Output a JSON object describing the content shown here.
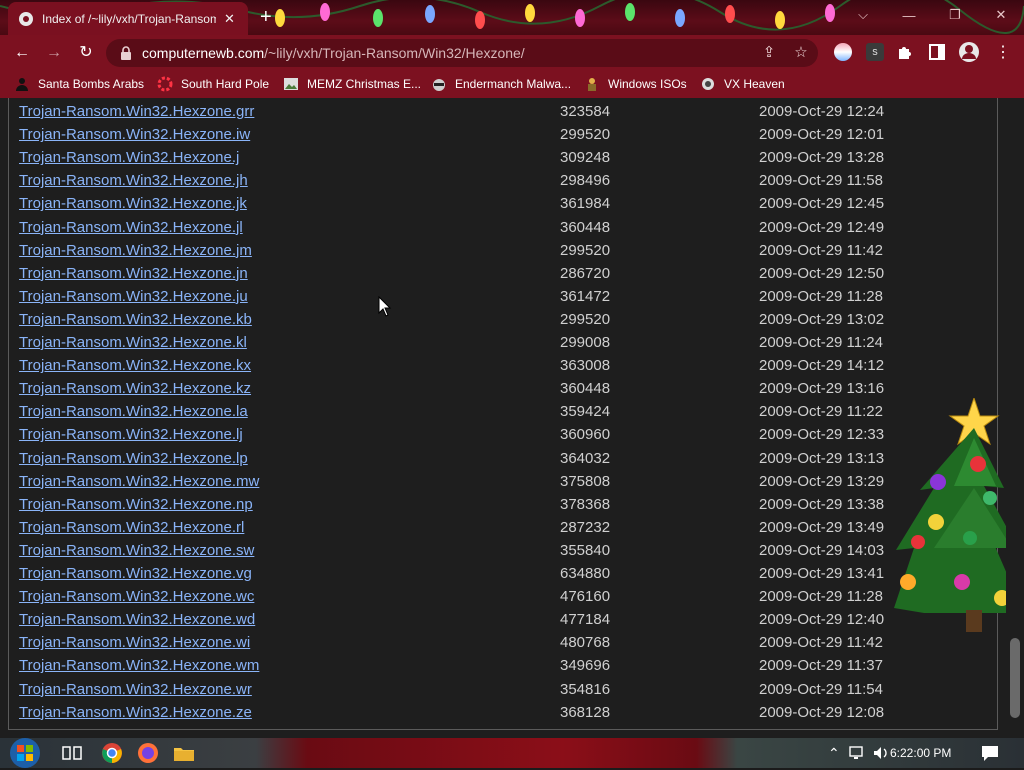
{
  "window": {
    "tab_title": "Index of /~lily/vxh/Trojan-Ransom",
    "tab_close": "✕",
    "new_tab": "+",
    "controls": [
      "⌵",
      "—",
      "❐",
      "✕"
    ]
  },
  "toolbar": {
    "back": "←",
    "forward": "→",
    "reload": "↻",
    "url_host": "computernewb.com",
    "url_path": "/~lily/vxh/Trojan-Ransom/Win32/Hexzone/",
    "share": "⇪",
    "bookmark_star": "☆",
    "menu": "⋮"
  },
  "bookmarks": [
    {
      "label": "Santa Bombs Arabs",
      "icon": "user-silhouette-icon"
    },
    {
      "label": "South Hard Pole",
      "icon": "red-flower-icon"
    },
    {
      "label": "MEMZ Christmas E...",
      "icon": "image-icon"
    },
    {
      "label": "Endermanch Malwa...",
      "icon": "raccoon-icon"
    },
    {
      "label": "Windows ISOs",
      "icon": "miner-icon"
    },
    {
      "label": "VX Heaven",
      "icon": "vx-icon"
    }
  ],
  "listing": [
    {
      "name": "Trojan-Ransom.Win32.Hexzone.grr",
      "size": "323584",
      "date": "2009-Oct-29 12:24"
    },
    {
      "name": "Trojan-Ransom.Win32.Hexzone.iw",
      "size": "299520",
      "date": "2009-Oct-29 12:01"
    },
    {
      "name": "Trojan-Ransom.Win32.Hexzone.j",
      "size": "309248",
      "date": "2009-Oct-29 13:28"
    },
    {
      "name": "Trojan-Ransom.Win32.Hexzone.jh",
      "size": "298496",
      "date": "2009-Oct-29 11:58"
    },
    {
      "name": "Trojan-Ransom.Win32.Hexzone.jk",
      "size": "361984",
      "date": "2009-Oct-29 12:45"
    },
    {
      "name": "Trojan-Ransom.Win32.Hexzone.jl",
      "size": "360448",
      "date": "2009-Oct-29 12:49"
    },
    {
      "name": "Trojan-Ransom.Win32.Hexzone.jm",
      "size": "299520",
      "date": "2009-Oct-29 11:42"
    },
    {
      "name": "Trojan-Ransom.Win32.Hexzone.jn",
      "size": "286720",
      "date": "2009-Oct-29 12:50"
    },
    {
      "name": "Trojan-Ransom.Win32.Hexzone.ju",
      "size": "361472",
      "date": "2009-Oct-29 11:28"
    },
    {
      "name": "Trojan-Ransom.Win32.Hexzone.kb",
      "size": "299520",
      "date": "2009-Oct-29 13:02"
    },
    {
      "name": "Trojan-Ransom.Win32.Hexzone.kl",
      "size": "299008",
      "date": "2009-Oct-29 11:24"
    },
    {
      "name": "Trojan-Ransom.Win32.Hexzone.kx",
      "size": "363008",
      "date": "2009-Oct-29 14:12"
    },
    {
      "name": "Trojan-Ransom.Win32.Hexzone.kz",
      "size": "360448",
      "date": "2009-Oct-29 13:16"
    },
    {
      "name": "Trojan-Ransom.Win32.Hexzone.la",
      "size": "359424",
      "date": "2009-Oct-29 11:22"
    },
    {
      "name": "Trojan-Ransom.Win32.Hexzone.lj",
      "size": "360960",
      "date": "2009-Oct-29 12:33"
    },
    {
      "name": "Trojan-Ransom.Win32.Hexzone.lp",
      "size": "364032",
      "date": "2009-Oct-29 13:13"
    },
    {
      "name": "Trojan-Ransom.Win32.Hexzone.mw",
      "size": "375808",
      "date": "2009-Oct-29 13:29"
    },
    {
      "name": "Trojan-Ransom.Win32.Hexzone.np",
      "size": "378368",
      "date": "2009-Oct-29 13:38"
    },
    {
      "name": "Trojan-Ransom.Win32.Hexzone.rl",
      "size": "287232",
      "date": "2009-Oct-29 13:49"
    },
    {
      "name": "Trojan-Ransom.Win32.Hexzone.sw",
      "size": "355840",
      "date": "2009-Oct-29 14:03"
    },
    {
      "name": "Trojan-Ransom.Win32.Hexzone.vg",
      "size": "634880",
      "date": "2009-Oct-29 13:41"
    },
    {
      "name": "Trojan-Ransom.Win32.Hexzone.wc",
      "size": "476160",
      "date": "2009-Oct-29 11:28"
    },
    {
      "name": "Trojan-Ransom.Win32.Hexzone.wd",
      "size": "477184",
      "date": "2009-Oct-29 12:40"
    },
    {
      "name": "Trojan-Ransom.Win32.Hexzone.wi",
      "size": "480768",
      "date": "2009-Oct-29 11:42"
    },
    {
      "name": "Trojan-Ransom.Win32.Hexzone.wm",
      "size": "349696",
      "date": "2009-Oct-29 11:37"
    },
    {
      "name": "Trojan-Ransom.Win32.Hexzone.wr",
      "size": "354816",
      "date": "2009-Oct-29 11:54"
    },
    {
      "name": "Trojan-Ransom.Win32.Hexzone.ze",
      "size": "368128",
      "date": "2009-Oct-29 12:08"
    }
  ],
  "taskbar": {
    "tray_up": "⌃",
    "clock": "6:22:00 PM"
  },
  "colors": {
    "link": "#8ab4f8",
    "chrome_theme": "#7c1120",
    "page_bg": "#1e1e1e"
  }
}
